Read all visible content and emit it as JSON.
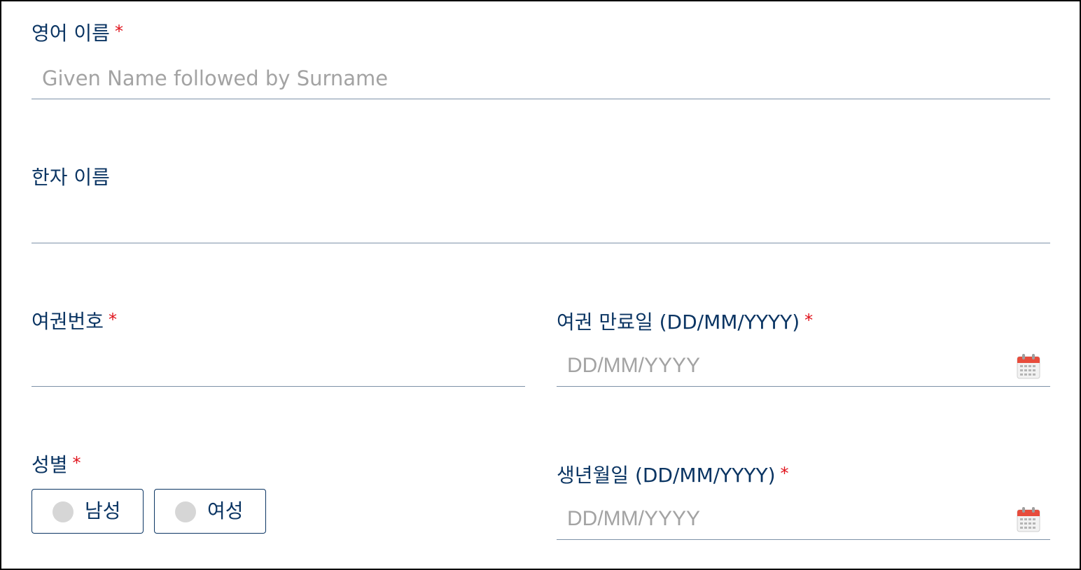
{
  "form": {
    "english_name": {
      "label": "영어 이름",
      "required_mark": "*",
      "placeholder": "Given Name followed by Surname",
      "value": ""
    },
    "hanja_name": {
      "label": "한자 이름",
      "placeholder": "",
      "value": ""
    },
    "passport_number": {
      "label": "여권번호",
      "required_mark": "*",
      "placeholder": "",
      "value": ""
    },
    "passport_expiry": {
      "label": "여권 만료일 (DD/MM/YYYY)",
      "required_mark": "*",
      "placeholder": "DD/MM/YYYY",
      "value": "",
      "icon": "calendar-icon"
    },
    "gender": {
      "label": "성별",
      "required_mark": "*",
      "options": [
        "남성",
        "여성"
      ],
      "selected": null
    },
    "birth_date": {
      "label": "생년월일 (DD/MM/YYYY)",
      "required_mark": "*",
      "placeholder": "DD/MM/YYYY",
      "value": "",
      "icon": "calendar-icon"
    }
  },
  "colors": {
    "label": "#0b3563",
    "required": "#e0121b",
    "placeholder": "#a3a3a3",
    "underline": "#7d92a8",
    "radio_dot": "#d6d6d6",
    "calendar_header": "#e74c3c"
  }
}
